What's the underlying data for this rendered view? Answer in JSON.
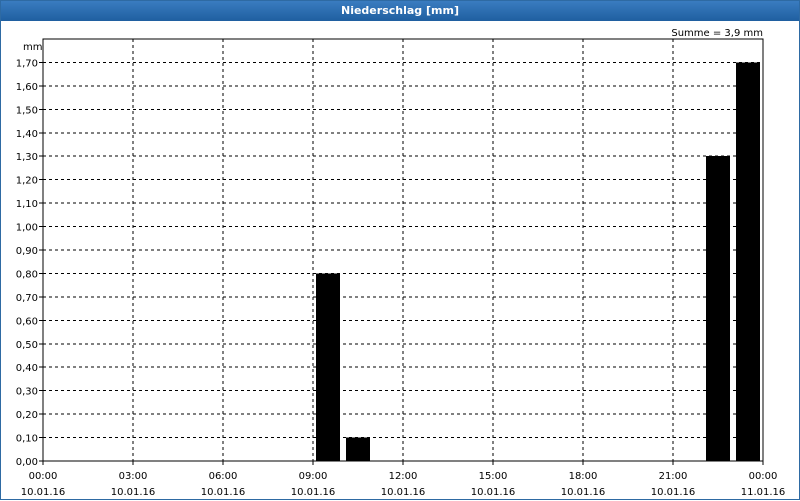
{
  "window": {
    "title": "Niederschlag [mm]"
  },
  "chart_data": {
    "type": "bar",
    "title": "Niederschlag [mm]",
    "ylabel": "mm",
    "summary": "Summe = 3,9 mm",
    "ylim": [
      0,
      1.8
    ],
    "yticks": [
      "0,00",
      "0,10",
      "0,20",
      "0,30",
      "0,40",
      "0,50",
      "0,60",
      "0,70",
      "0,80",
      "0,90",
      "1,00",
      "1,10",
      "1,20",
      "1,30",
      "1,40",
      "1,50",
      "1,60",
      "1,70"
    ],
    "xticks": [
      {
        "time": "00:00",
        "date": "10.01.16"
      },
      {
        "time": "03:00",
        "date": "10.01.16"
      },
      {
        "time": "06:00",
        "date": "10.01.16"
      },
      {
        "time": "09:00",
        "date": "10.01.16"
      },
      {
        "time": "12:00",
        "date": "10.01.16"
      },
      {
        "time": "15:00",
        "date": "10.01.16"
      },
      {
        "time": "18:00",
        "date": "10.01.16"
      },
      {
        "time": "21:00",
        "date": "10.01.16"
      },
      {
        "time": "00:00",
        "date": "11.01.16"
      }
    ],
    "xlim": [
      "10.01.16 00:00",
      "11.01.16 00:00"
    ],
    "bars": [
      {
        "start": "10.01.16 09:00",
        "end": "10.01.16 10:00",
        "value": 0.8
      },
      {
        "start": "10.01.16 10:00",
        "end": "10.01.16 11:00",
        "value": 0.1
      },
      {
        "start": "10.01.16 22:00",
        "end": "10.01.16 23:00",
        "value": 1.3
      },
      {
        "start": "10.01.16 23:00",
        "end": "11.01.16 00:00",
        "value": 1.7
      }
    ],
    "grid": true,
    "bar_color": "#000000"
  }
}
